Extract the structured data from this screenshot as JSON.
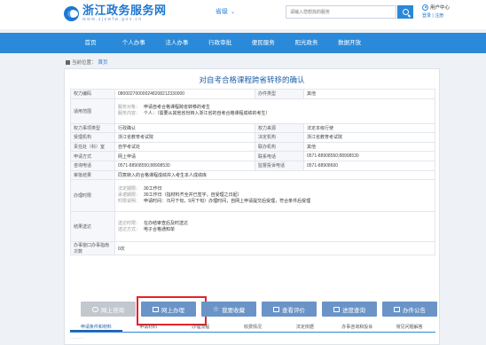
{
  "header": {
    "site_title": "浙江政务服务网",
    "site_sub": "www.zjzwfw.gov.cn",
    "province": "省级",
    "search_placeholder": "请输入您想找的服务",
    "user_label": "用户中心",
    "user_links": "登录 | 注册"
  },
  "nav": [
    "首页",
    "个人办事",
    "法人办事",
    "行政审批",
    "便民服务",
    "阳光政务",
    "数据开放"
  ],
  "breadcrumb": {
    "prefix": "当前位置：",
    "home": "首页"
  },
  "page_title": "对自考合格课程跨省转移的确认",
  "rows": {
    "r1": {
      "l1": "权力编码",
      "v1": "080002700000248208212330000",
      "l2": "办件类型",
      "v2": "其他"
    },
    "r2": {
      "l1": "适用范围",
      "k1": "服务对象：",
      "t1": "申请自考合格课程跨省转移的考生",
      "k2": "服务内容：",
      "t2": "个人：（需要从其他省份转入浙江省的自考合格课程成绩的考生）"
    },
    "r3": {
      "l1": "权力事项类型",
      "v1": "行政确认",
      "l2": "权力来源",
      "v2": "法定本级行使"
    },
    "r4": {
      "l1": "受理机构",
      "v1": "浙江省教育考试院",
      "l2": "决定机构",
      "v2": "浙江省教育考试院"
    },
    "r5": {
      "l1": "责任处（科）室",
      "v1": "自学考试处",
      "l2": "联办机构",
      "v2": "其他"
    },
    "r6": {
      "l1": "申请方式",
      "v1": "网上申请",
      "l2": "联系电话",
      "v2": "0571-88908550;88908530"
    },
    "r7": {
      "l1": "咨询电话",
      "v1": "0571-88908550;88908530",
      "l2": "监督投诉电话",
      "v2": "0571-88908600"
    },
    "r8": {
      "l1": "审批结果",
      "v1": "同意转入的合格课程成绩并入考生本人成绩库"
    },
    "r9": {
      "l1": "办理时限",
      "k1": "法定期限：",
      "t1": "30工作日",
      "k2": "承诺期限：",
      "t2": "30工作日（指材料齐全并已签字，自受理之日起）",
      "k3": "时限说明：",
      "t3": "申请时间：（5月下旬，9月下旬）办理时间，自网上申请提交后受理，符合条件后受理"
    },
    "r10": {
      "l1": "结果送达",
      "k1": "送达时限：",
      "t1": "在办结审查后及时送达",
      "k2": "送达方式：",
      "t2": "电子合格通知单"
    },
    "r11": {
      "l1": "办事窗口办事指南次数",
      "v1": "0次"
    }
  },
  "buttons": {
    "consult": "网上咨询",
    "online": "网上办理",
    "favorite": "我要收藏",
    "review": "查看评价",
    "progress": "进度查询",
    "notice": "办件公告"
  },
  "tabs": [
    "申请条件和材料",
    "申请材料",
    "办理流程",
    "收费情况",
    "法定依据",
    "办事咨询和投诉",
    "常见问题解答"
  ],
  "dots": "………"
}
